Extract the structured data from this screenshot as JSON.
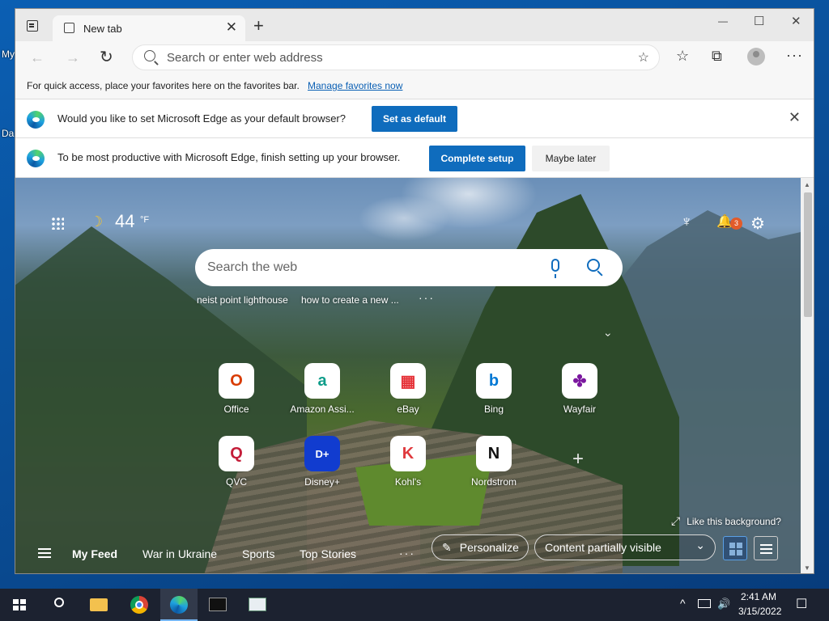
{
  "desktop": {
    "label_1": "My",
    "label_2": "Da"
  },
  "window": {
    "tab_title": "New tab",
    "tab_close_glyph": "✕",
    "new_tab_glyph": "+",
    "controls": {
      "minimize": "—",
      "maximize": "☐",
      "close": "✕"
    }
  },
  "toolbar": {
    "back_glyph": "←",
    "forward_glyph": "→",
    "refresh_glyph": "↻",
    "address_placeholder": "Search or enter web address",
    "add_favorite_glyph": "☆",
    "favorites_glyph": "☆",
    "collections_glyph": "⧉",
    "more_glyph": "···"
  },
  "favbar": {
    "text": "For quick access, place your favorites here on the favorites bar.",
    "link": "Manage favorites now"
  },
  "infobar_default": {
    "text": "Would you like to set Microsoft Edge as your default browser?",
    "button": "Set as default",
    "close_glyph": "✕"
  },
  "infobar_setup": {
    "text": "To be most productive with Microsoft Edge, finish setting up your browser.",
    "primary_button": "Complete setup",
    "secondary_button": "Maybe later"
  },
  "ntp": {
    "weather": {
      "icon": "☽",
      "temperature": "44",
      "unit": "°F"
    },
    "rewards_glyph": "♆",
    "bell_glyph": "🔔",
    "notification_count": "3",
    "settings_glyph": "⚙",
    "search_placeholder": "Search the web",
    "recent_searches": [
      "neist point lighthouse",
      "how to create a new ..."
    ],
    "recent_more": "···",
    "collapse_glyph": "‹",
    "quick_links": [
      {
        "label": "Office",
        "glyph": "O",
        "color": "#d83b01"
      },
      {
        "label": "Amazon Assi...",
        "glyph": "a",
        "color": "#0f9d8a"
      },
      {
        "label": "eBay",
        "glyph": "▦",
        "color": "#e53238"
      },
      {
        "label": "Bing",
        "glyph": "b",
        "color": "#0078d4"
      },
      {
        "label": "Wayfair",
        "glyph": "✤",
        "color": "#7b189f"
      },
      {
        "label": "QVC",
        "glyph": "Q",
        "color": "#c41e3a"
      },
      {
        "label": "Disney+",
        "glyph": "D+",
        "color": "#113ccf"
      },
      {
        "label": "Kohl's",
        "glyph": "K",
        "color": "#e03a3e"
      },
      {
        "label": "Nordstrom",
        "glyph": "N",
        "color": "#111111"
      }
    ],
    "add_site_glyph": "+",
    "like_background": "Like this background?",
    "expand_glyph": "⤢",
    "feed": {
      "tabs": [
        "My Feed",
        "War in Ukraine",
        "Sports",
        "Top Stories"
      ],
      "more_glyph": "···",
      "personalize": "Personalize",
      "personalize_glyph": "✎",
      "content_visibility": "Content partially visible",
      "dropdown_glyph": "⌄"
    }
  },
  "taskbar": {
    "time": "2:41 AM",
    "date": "3/15/2022",
    "apps": [
      "start",
      "search",
      "file-explorer",
      "chrome",
      "edge",
      "terminal",
      "app"
    ],
    "tray_up_glyph": "^",
    "volume_glyph": "🔊",
    "notification_glyph": "☐"
  }
}
